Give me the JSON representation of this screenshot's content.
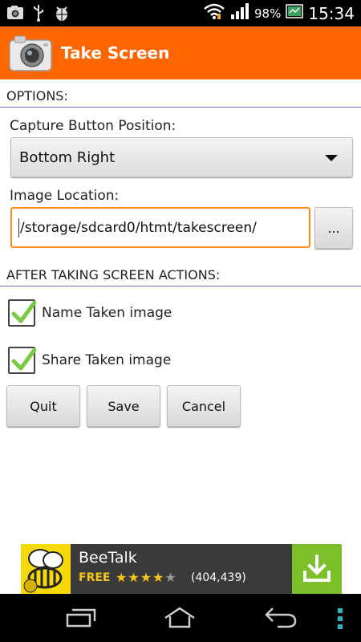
{
  "status_bar": {
    "battery_percent": "98%",
    "time": "15:34",
    "icons": [
      "screenshot-icon",
      "usb-icon",
      "android-debug-icon",
      "wifi-icon",
      "signal-icon",
      "battery-icon"
    ]
  },
  "title_bar": {
    "title": "Take Screen",
    "icon": "camera-icon",
    "background": "#ff6600"
  },
  "options": {
    "header": "OPTIONS:",
    "capture_label": "Capture Button Position:",
    "capture_value": "Bottom Right",
    "location_label": "Image Location:",
    "location_value": "/storage/sdcard0/htmt/takescreen/",
    "browse_label": "..."
  },
  "actions": {
    "header": "AFTER TAKING SCREEN ACTIONS:",
    "items": [
      {
        "label": "Name Taken image",
        "checked": true
      },
      {
        "label": "Share Taken image",
        "checked": true
      }
    ]
  },
  "buttons": {
    "quit": "Quit",
    "save": "Save",
    "cancel": "Cancel"
  },
  "ad": {
    "title": "BeeTalk",
    "price": "FREE",
    "rating": 4,
    "rating_max": 5,
    "reviews": "(404,439)",
    "icon": "beetalk-icon",
    "download_icon": "download-icon"
  },
  "nav_bar": {
    "icons": [
      "recent-apps-icon",
      "home-icon",
      "back-icon",
      "menu-icon"
    ]
  }
}
